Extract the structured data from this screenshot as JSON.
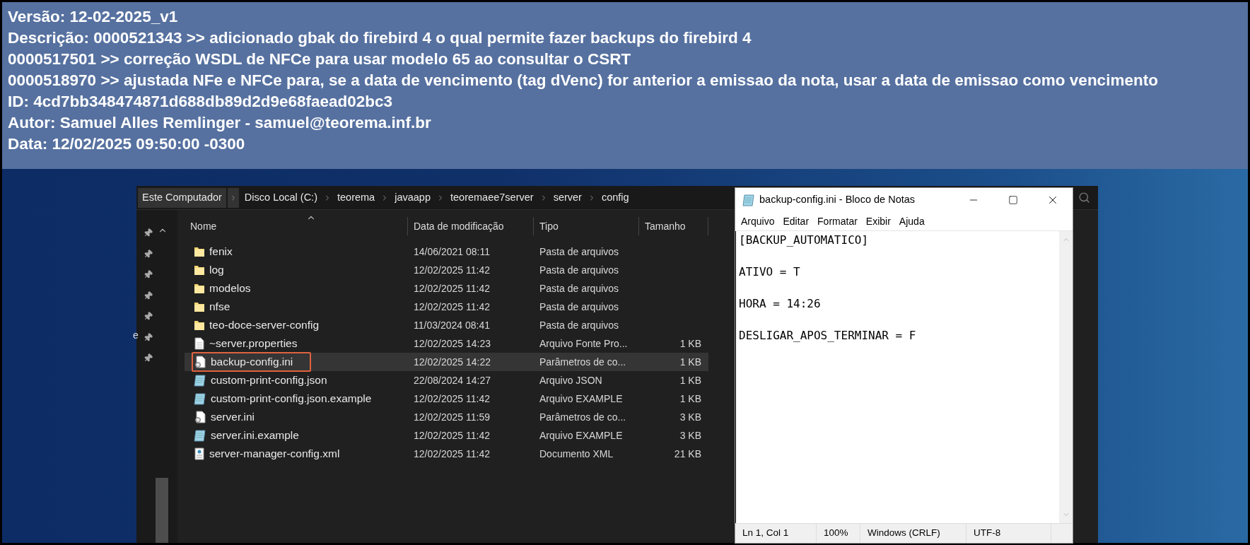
{
  "commit_info": {
    "lines": [
      "Versão: 12-02-2025_v1",
      "Descrição: 0000521343 >> adicionado gbak do firebird 4 o qual permite fazer backups do firebird 4",
      "0000517501 >> correção WSDL de NFCe para usar modelo 65 ao consultar o CSRT",
      "0000518970 >> ajustada NFe e NFCe para, se a data de vencimento (tag dVenc) for anterior a emissao da nota, usar a data de emissao como vencimento",
      "ID: 4cd7bb348474871d688db89d2d9e68faead02bc3",
      "Autor: Samuel Alles Remlinger - samuel@teorema.inf.br",
      "Data: 12/02/2025 09:50:00 -0300"
    ]
  },
  "explorer": {
    "breadcrumb": [
      {
        "label": "Este Computador",
        "selected": true
      },
      {
        "label": "Disco Local (C:)",
        "selected": false
      },
      {
        "label": "teorema",
        "selected": false
      },
      {
        "label": "javaapp",
        "selected": false
      },
      {
        "label": "teoremaee7server",
        "selected": false
      },
      {
        "label": "server",
        "selected": false
      },
      {
        "label": "config",
        "selected": false
      }
    ],
    "nav_fragment": "e",
    "columns": [
      "Nome",
      "Data de modificação",
      "Tipo",
      "Tamanho"
    ],
    "files": [
      {
        "name": "fenix",
        "modified": "14/06/2021 08:11",
        "type": "Pasta de arquivos",
        "kind": "folder",
        "selected": false
      },
      {
        "name": "log",
        "modified": "12/02/2025 11:42",
        "type": "Pasta de arquivos",
        "kind": "folder",
        "selected": false
      },
      {
        "name": "modelos",
        "modified": "12/02/2025 11:42",
        "type": "Pasta de arquivos",
        "kind": "folder",
        "selected": false
      },
      {
        "name": "nfse",
        "modified": "12/02/2025 11:42",
        "type": "Pasta de arquivos",
        "kind": "folder",
        "selected": false
      },
      {
        "name": "teo-doce-server-config",
        "modified": "11/03/2024 08:41",
        "type": "Pasta de arquivos",
        "kind": "folder",
        "selected": false
      },
      {
        "name": "~server.properties",
        "modified": "12/02/2025 14:23",
        "type": "Arquivo Fonte Pro...",
        "size": "1 KB",
        "kind": "text",
        "selected": false
      },
      {
        "name": "backup-config.ini",
        "modified": "12/02/2025 14:22",
        "type": "Parâmetros de co...",
        "size": "1 KB",
        "kind": "settings",
        "selected": true
      },
      {
        "name": "custom-print-config.json",
        "modified": "22/08/2024 14:27",
        "type": "Arquivo JSON",
        "size": "1 KB",
        "kind": "notepad",
        "selected": false
      },
      {
        "name": "custom-print-config.json.example",
        "modified": "12/02/2025 11:42",
        "type": "Arquivo EXAMPLE",
        "size": "1 KB",
        "kind": "notepad",
        "selected": false
      },
      {
        "name": "server.ini",
        "modified": "12/02/2025 11:59",
        "type": "Parâmetros de co...",
        "size": "3 KB",
        "kind": "settings",
        "selected": false
      },
      {
        "name": "server.ini.example",
        "modified": "12/02/2025 11:42",
        "type": "Arquivo EXAMPLE",
        "size": "3 KB",
        "kind": "notepad",
        "selected": false
      },
      {
        "name": "server-manager-config.xml",
        "modified": "12/02/2025 11:42",
        "type": "Documento XML",
        "size": "21 KB",
        "kind": "xml",
        "selected": false
      }
    ]
  },
  "notepad": {
    "title": "backup-config.ini - Bloco de Notas",
    "menu": [
      "Arquivo",
      "Editar",
      "Formatar",
      "Exibir",
      "Ajuda"
    ],
    "lines": [
      "[BACKUP_AUTOMATICO]",
      "ATIVO = T",
      "HORA = 14:26",
      "DESLIGAR_APOS_TERMINAR = F"
    ],
    "status": [
      "Ln 1, Col 1",
      "100%",
      "Windows (CRLF)",
      "UTF-8"
    ]
  }
}
